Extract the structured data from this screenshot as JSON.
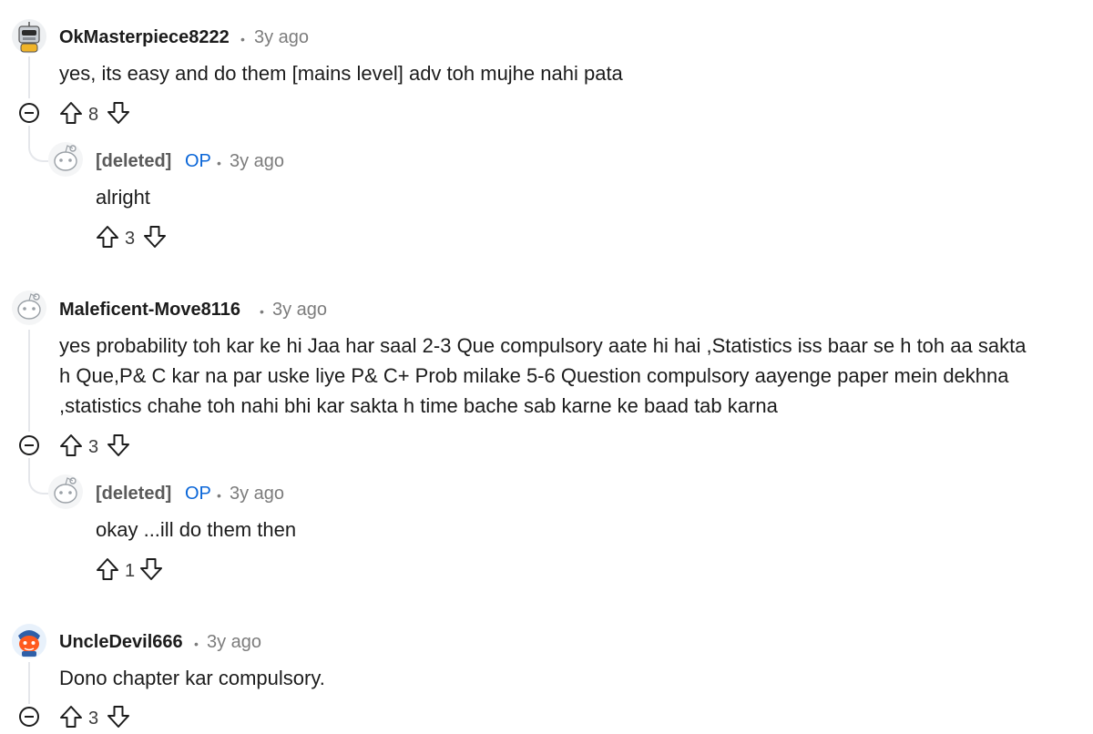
{
  "comments": [
    {
      "author": "OkMasterpiece8222",
      "separator": "•",
      "time": "3y ago",
      "text": "yes, its easy and do them [mains level] adv toh mujhe nahi pata",
      "score": "8",
      "avatar_icon": "robot-avatar-icon",
      "reply": {
        "author": "[deleted]",
        "op": "OP",
        "separator": "•",
        "time": "3y ago",
        "text": "alright",
        "score": "3"
      }
    },
    {
      "author": "Maleficent-Move8116",
      "separator": "•",
      "time": "3y ago",
      "text_lines": [
        "yes probability toh kar ke hi Jaa har saal 2-3 Que compulsory aate hi hai ,Statistics iss baar se h toh aa sakta",
        "h Que,P& C kar na par uske liye P& C+ Prob milake 5-6 Question compulsory aayenge paper mein dekhna",
        ",statistics chahe toh nahi bhi kar sakta h time bache sab karne ke baad tab karna"
      ],
      "score": "3",
      "reply": {
        "author": "[deleted]",
        "op": "OP",
        "separator": "•",
        "time": "3y ago",
        "text": "okay ...ill do them then",
        "score": "1"
      }
    },
    {
      "author": "UncleDevil666",
      "separator": "•",
      "time": "3y ago",
      "text": "Dono chapter kar compulsory.",
      "score": "3",
      "avatar_icon": "orange-snoo-avatar-icon"
    }
  ],
  "colors": {
    "op": "#0a66d8",
    "meta": "#7c7c7c",
    "thread_line": "#e5e7eb"
  }
}
